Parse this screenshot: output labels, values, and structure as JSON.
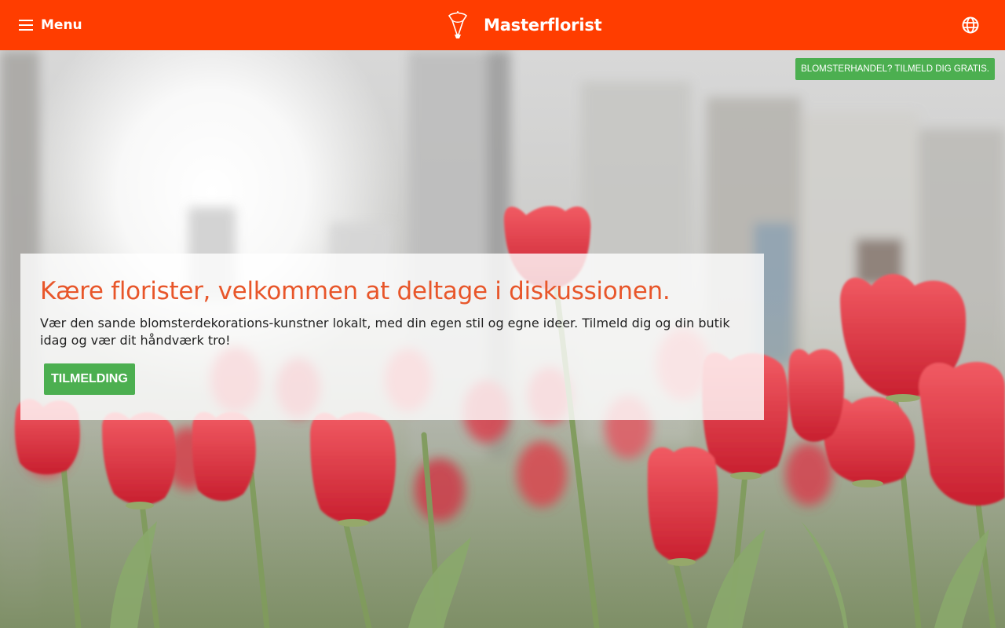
{
  "header": {
    "menu_label": "Menu",
    "brand_name": "Masterflorist",
    "menu_icon": "hamburger-icon",
    "logo_icon": "bouquet-logo",
    "language_icon": "globe-icon",
    "background_color": "#ff3d00"
  },
  "hero": {
    "top_cta": "BLOMSTERHANDEL? TILMELD DIG GRATIS.",
    "title": "Kære florister, velkommen at deltage i diskussionen.",
    "description": "Vær den sande blomsterdekorations-kunstner lokalt, med din egen stil og egne ideer. Tilmeld dig og din butik idag og vær dit håndværk tro!",
    "button_label": "TILMELDING",
    "title_color": "#e8562a",
    "button_color": "#4caf50"
  }
}
